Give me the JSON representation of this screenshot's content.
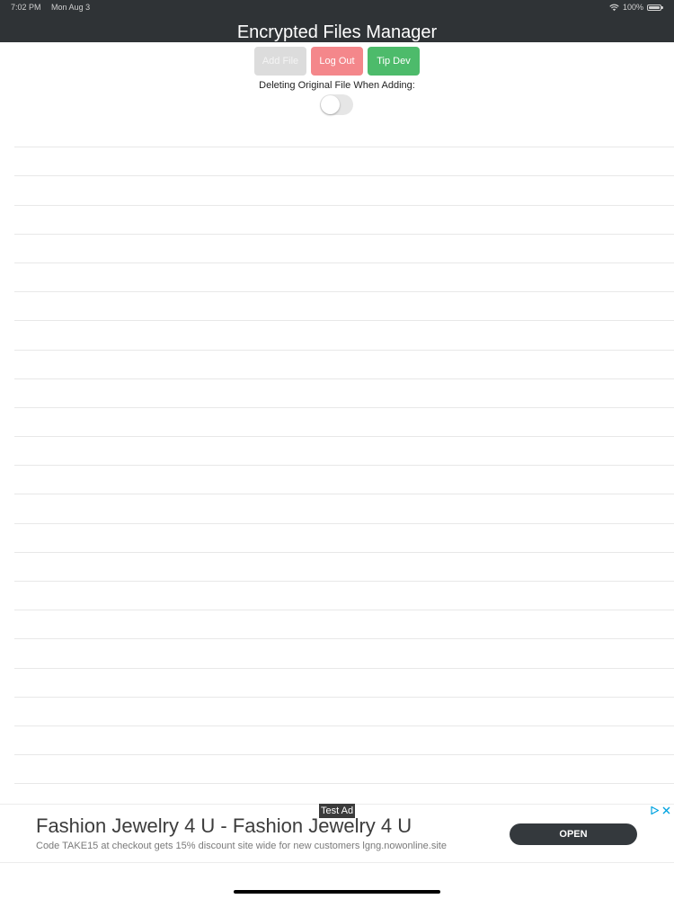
{
  "status_bar": {
    "time": "7:02 PM",
    "date": "Mon Aug 3",
    "battery": "100%"
  },
  "header": {
    "title": "Encrypted Files Manager"
  },
  "toolbar": {
    "add_file_label": "Add File",
    "log_out_label": "Log Out",
    "tip_dev_label": "Tip Dev"
  },
  "settings": {
    "delete_original_label": "Deleting Original File When Adding:",
    "delete_original_enabled": false
  },
  "file_list": {
    "rows": 23
  },
  "ad": {
    "tag": "Test Ad",
    "headline": "Fashion Jewelry 4 U - Fashion Jewelry 4 U",
    "body": "Code TAKE15 at checkout gets 15% discount site wide for new customers lgng.nowonline.site",
    "cta": "OPEN"
  },
  "colors": {
    "header_bg": "#2f3336",
    "add_file_button": "#dcdcdc",
    "log_out_button": "#f4878b",
    "tip_dev_button": "#4dbb6b",
    "ad_cta_bg": "#34393d"
  }
}
